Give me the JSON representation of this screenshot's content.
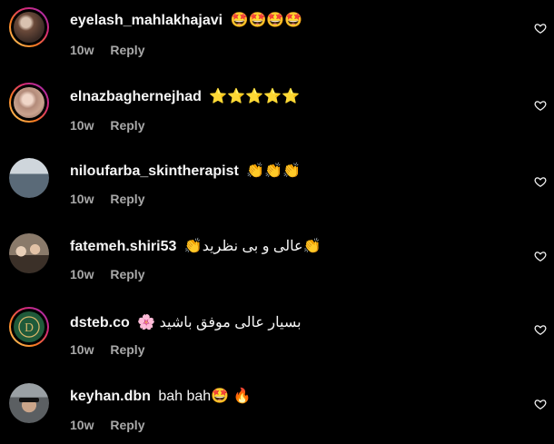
{
  "colors": {
    "background": "#000000",
    "text_primary": "#f5f5f5",
    "text_secondary": "#a8a8a8"
  },
  "comments": [
    {
      "username": "eyelash_mahlakhajavi",
      "text": "🤩🤩🤩🤩",
      "time": "10w",
      "reply_label": "Reply",
      "avatar_icon": "profile-photo",
      "story_ring": true
    },
    {
      "username": "elnazbaghernejhad",
      "text": "⭐️⭐️⭐️⭐️⭐️",
      "time": "10w",
      "reply_label": "Reply",
      "avatar_icon": "profile-photo",
      "story_ring": true
    },
    {
      "username": "niloufarba_skintherapist",
      "text": "👏👏👏",
      "time": "10w",
      "reply_label": "Reply",
      "avatar_icon": "profile-photo",
      "story_ring": false
    },
    {
      "username": "fatemeh.shiri53",
      "text": "👏عالی و بی نظرید👏",
      "time": "10w",
      "reply_label": "Reply",
      "avatar_icon": "profile-photo",
      "story_ring": false
    },
    {
      "username": "dsteb.co",
      "text": "🌸 بسیار عالی موفق باشید",
      "time": "10w",
      "reply_label": "Reply",
      "avatar_icon": "brand-logo",
      "story_ring": true
    },
    {
      "username": "keyhan.dbn",
      "text": "bah bah🤩 🔥",
      "time": "10w",
      "reply_label": "Reply",
      "avatar_icon": "profile-photo",
      "story_ring": false
    }
  ]
}
